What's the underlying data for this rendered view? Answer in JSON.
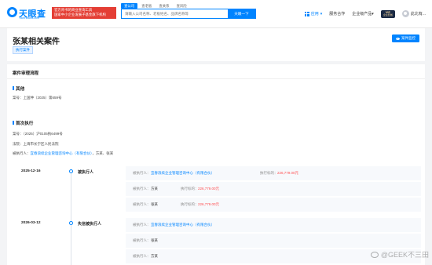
{
  "header": {
    "logo_text": "天眼查",
    "logo_url": "TianYancha.com",
    "promo_line1": "官方背书的商业查询工具",
    "promo_line2": "国家中小企业发展子基金旗下机构",
    "search_tabs": [
      "查公司",
      "查老板",
      "查关系",
      "查风险"
    ],
    "search_placeholder": "请输入公司名称、老板姓名、品牌名称等",
    "search_button": "天眼一下",
    "nav_app": "应用",
    "nav_service": "服务合作",
    "nav_enterprise": "企业级产品",
    "vip_label": "VIP",
    "vip_sub": "企业套餐",
    "user_name": "此北有..."
  },
  "case": {
    "title": "张某相关案件",
    "tag": "执行案件",
    "monitor_button": "案件监控"
  },
  "process": {
    "heading": "案件审理流程",
    "other": {
      "title": "其他",
      "case_no": "案号：上国仲（2025）第659号"
    },
    "first_exec": {
      "title": "首次执行",
      "case_no": "案号：（2025）沪0105执6499号",
      "court": "法院：上海市长宁区人民法院",
      "executed_label": "被执行人：",
      "executed_company": "宜春浪续企业管理咨询中心（有限合伙）",
      "executed_rest": "，方某、张某"
    },
    "timeline": [
      {
        "date": "2025-12-16",
        "type": "被执行人",
        "rows": [
          {
            "label": "被执行人：",
            "value": "宜春浪续企业管理咨询中心（有限合伙）",
            "amount_label": "执行标的：",
            "amount": "226,779.00元"
          },
          {
            "label": "被执行人：",
            "value": "方某",
            "amount_label": "执行标的：",
            "amount": "226,779.00元"
          },
          {
            "label": "被执行人：",
            "value": "张某",
            "amount_label": "执行标的：",
            "amount": "226,779.00元"
          }
        ]
      },
      {
        "date": "2026-03-12",
        "type": "失信被执行人",
        "rows": [
          {
            "label": "被执行人：",
            "value": "宜春浪续企业管理咨询中心（有限合伙）"
          },
          {
            "label": "被执行人：",
            "value": "张某"
          },
          {
            "label": "被执行人：",
            "value": "方某"
          }
        ]
      }
    ]
  },
  "watermark": "@GEEK不三田",
  "colors": {
    "accent": "#0084ff",
    "amount": "#ff4d4f",
    "promo": "#e43e34"
  }
}
